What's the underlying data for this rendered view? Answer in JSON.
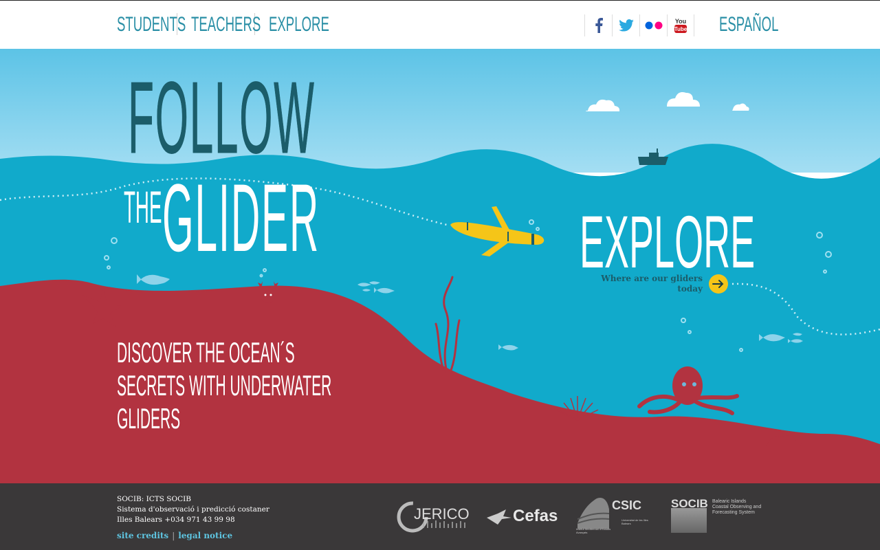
{
  "nav": {
    "items": [
      "STUDENTS",
      "TEACHERS",
      "EXPLORE"
    ],
    "lang": "ESPAÑOL"
  },
  "social": {
    "icons": [
      "facebook-icon",
      "twitter-icon",
      "flickr-icon",
      "youtube-icon"
    ],
    "youtube_text": "YOU TUBE"
  },
  "hero": {
    "title_follow": "FOLLOW",
    "title_the": "THE",
    "title_glider": "GLIDER",
    "tagline": [
      "DISCOVER THE OCEAN´S",
      "SECRETS WITH UNDERWATER",
      "GLIDERS"
    ],
    "explore_heading": "EXPLORE",
    "explore_link": [
      "Where are our gliders",
      "today"
    ]
  },
  "footer": {
    "lines": [
      "SOCIB: ICTS SOCIB",
      "Sistema d'observació i predicció costaner",
      "Illes Balears +034 971 43 99 98"
    ],
    "site_credits": "site credits",
    "separator": "|",
    "legal_notice": "legal notice"
  },
  "logos": {
    "jerico": "JERICO",
    "cefas": "Cefas",
    "csic": "CSIC",
    "csic_sub": "Institut Mediterrani d'Estudis Avançats",
    "csic_sub2": "Universitat de les Illes Balears",
    "socib": "SOCIB",
    "socib_sub": "Balearic Islands Coastal Observing and Forecasting System"
  },
  "colors": {
    "nav_text": "#2a8fa6",
    "sky_top": "#5cc3e6",
    "sky_bottom": "#9fdcf2",
    "sea": "#11aacb",
    "seabed": "#b23340",
    "glider": "#f5c518",
    "footer_bg": "#3a3839",
    "footer_link": "#5ec4e0"
  }
}
